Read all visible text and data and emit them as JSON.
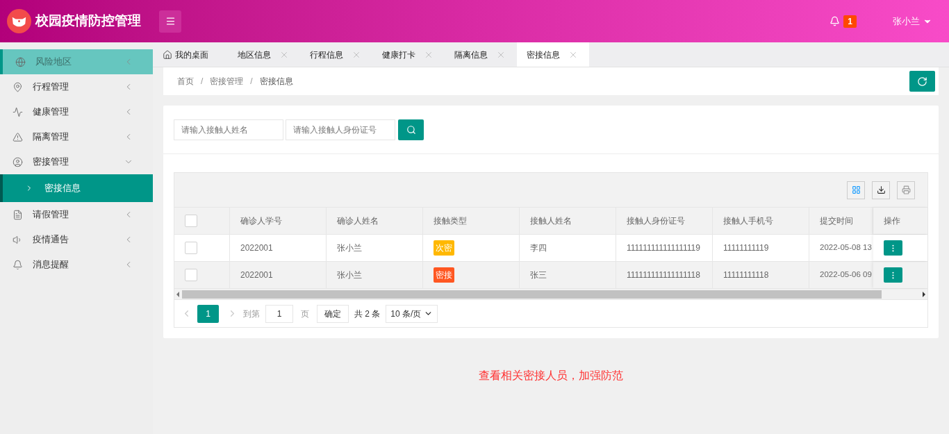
{
  "header": {
    "title": "校园疫情防控管理",
    "notification_count": "1",
    "user": "张小兰"
  },
  "sidebar": {
    "items": [
      {
        "label": "风险地区",
        "highlighted": true,
        "expanded": false
      },
      {
        "label": "行程管理",
        "highlighted": false,
        "expanded": false
      },
      {
        "label": "健康管理",
        "highlighted": false,
        "expanded": false
      },
      {
        "label": "隔离管理",
        "highlighted": false,
        "expanded": false
      },
      {
        "label": "密接管理",
        "highlighted": false,
        "expanded": true,
        "children": [
          {
            "label": "密接信息",
            "selected": true
          }
        ]
      },
      {
        "label": "请假管理",
        "highlighted": false,
        "expanded": false
      },
      {
        "label": "疫情通告",
        "highlighted": false,
        "expanded": false
      },
      {
        "label": "消息提醒",
        "highlighted": false,
        "expanded": false
      }
    ]
  },
  "tabs": [
    {
      "label": "我的桌面",
      "kind": "home",
      "selected": false
    },
    {
      "label": "地区信息",
      "kind": "closable",
      "selected": false
    },
    {
      "label": "行程信息",
      "kind": "closable",
      "selected": false
    },
    {
      "label": "健康打卡",
      "kind": "closable",
      "selected": false
    },
    {
      "label": "隔离信息",
      "kind": "closable",
      "selected": false
    },
    {
      "label": "密接信息",
      "kind": "closable",
      "selected": true
    }
  ],
  "breadcrumb": {
    "separator": "/",
    "items": [
      "首页",
      "密接管理",
      "密接信息"
    ]
  },
  "search": {
    "fields": [
      {
        "placeholder": "请输入接触人姓名"
      },
      {
        "placeholder": "请输入接触人身份证号"
      }
    ]
  },
  "table": {
    "all_checked": false,
    "columns": [
      "确诊人学号",
      "确诊人姓名",
      "接触类型",
      "接触人姓名",
      "接触人身份证号",
      "接触人手机号",
      "提交时间",
      "操作"
    ],
    "rows": [
      {
        "checked": false,
        "cells": [
          "2022001",
          "张小兰",
          "次密",
          "李四",
          "111111111111111119",
          "11111111119",
          "2022-05-08 13"
        ],
        "color": "#ffb800"
      },
      {
        "checked": false,
        "cells": [
          "2022001",
          "张小兰",
          "密接",
          "张三",
          "111111111111111118",
          "11111111118",
          "2022-05-06 09"
        ],
        "color": "#ff5722"
      }
    ]
  },
  "pagination": {
    "current": "1",
    "goto_label": "到第",
    "goto_value": "1",
    "page_label": "页",
    "confirm": "确定",
    "total": "共 2 条",
    "page_size": "10 条/页"
  },
  "footer_note": "查看相关密接人员，加强防范"
}
